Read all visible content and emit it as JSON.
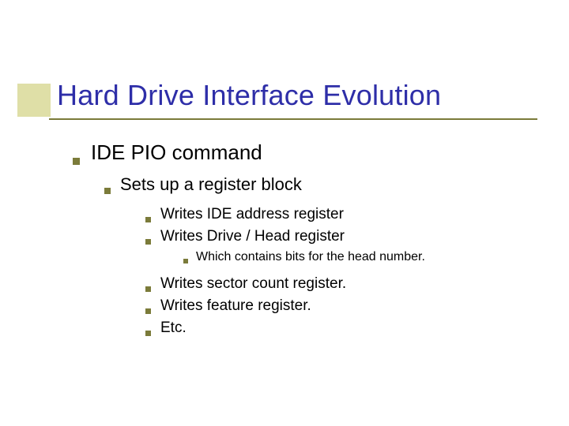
{
  "title": "Hard Drive Interface Evolution",
  "bullets": {
    "l1": "IDE PIO command",
    "l2": "Sets up a register block",
    "l3a": "Writes IDE address register",
    "l3b": "Writes Drive / Head register",
    "l4": "Which contains bits for the head number.",
    "l3c": "Writes sector count register.",
    "l3d": "Writes feature register.",
    "l3e": "Etc."
  }
}
